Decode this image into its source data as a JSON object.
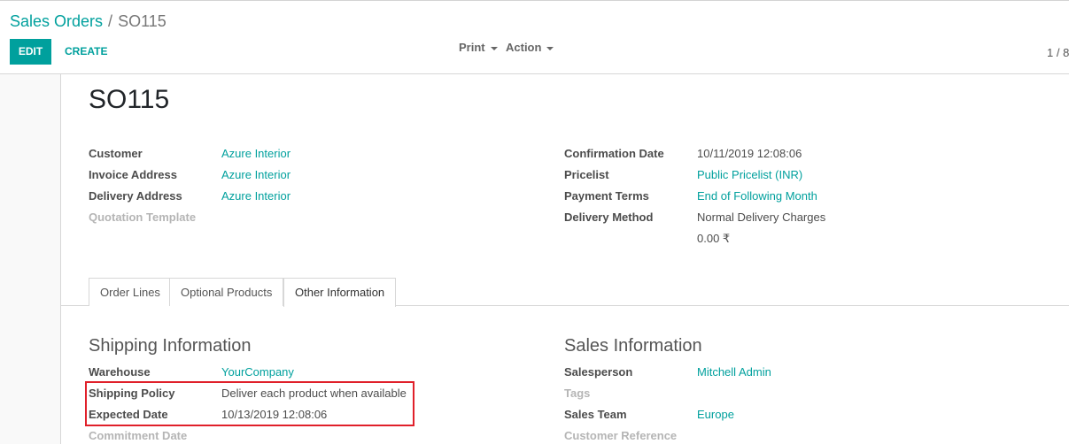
{
  "breadcrumb": {
    "parent": "Sales Orders",
    "separator": "/",
    "current": "SO115"
  },
  "toolbar": {
    "edit_label": "EDIT",
    "create_label": "CREATE",
    "print_label": "Print",
    "action_label": "Action",
    "pager": "1 / 8"
  },
  "record": {
    "title": "SO115",
    "left_fields": [
      {
        "label": "Customer",
        "value": "Azure Interior"
      },
      {
        "label": "Invoice Address",
        "value": "Azure Interior"
      },
      {
        "label": "Delivery Address",
        "value": "Azure Interior"
      },
      {
        "label": "Quotation Template",
        "value": ""
      }
    ],
    "right_fields": [
      {
        "label": "Confirmation Date",
        "value": "10/11/2019 12:08:06"
      },
      {
        "label": "Pricelist",
        "value": "Public Pricelist (INR)"
      },
      {
        "label": "Payment Terms",
        "value": "End of Following Month"
      },
      {
        "label": "Delivery Method",
        "value": "Normal Delivery Charges"
      }
    ],
    "delivery_price": "0.00 ₹"
  },
  "tabs": [
    {
      "label": "Order Lines"
    },
    {
      "label": "Optional Products"
    },
    {
      "label": "Other Information"
    }
  ],
  "shipping": {
    "title": "Shipping Information",
    "fields": [
      {
        "label": "Warehouse",
        "value": "YourCompany"
      },
      {
        "label": "Shipping Policy",
        "value": "Deliver each product when available"
      },
      {
        "label": "Expected Date",
        "value": "10/13/2019 12:08:06"
      },
      {
        "label": "Commitment Date",
        "value": ""
      }
    ]
  },
  "sales": {
    "title": "Sales Information",
    "fields": [
      {
        "label": "Salesperson",
        "value": "Mitchell Admin"
      },
      {
        "label": "Tags",
        "value": ""
      },
      {
        "label": "Sales Team",
        "value": "Europe"
      },
      {
        "label": "Customer Reference",
        "value": ""
      }
    ]
  },
  "colors": {
    "accent": "#00a09d",
    "highlight": "#e0202a"
  }
}
